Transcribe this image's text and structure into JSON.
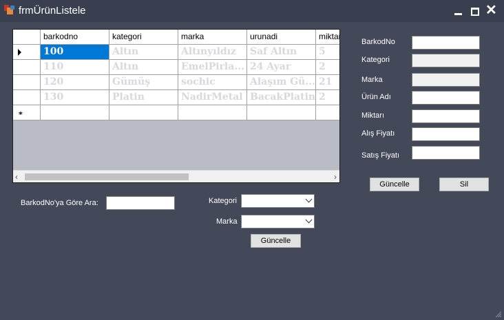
{
  "window": {
    "title": "frmÜrünListele"
  },
  "grid": {
    "columns": [
      "barkodno",
      "kategori",
      "marka",
      "urunadi",
      "miktar"
    ],
    "rows": [
      [
        "100",
        "Altın",
        "Altınyıldız",
        "Saf Altın",
        "5"
      ],
      [
        "110",
        "Altın",
        "EmelPirla...",
        "24 Ayar",
        "2"
      ],
      [
        "120",
        "Gümüş",
        "sochic",
        "Alaşım Gü...",
        "21"
      ],
      [
        "130",
        "Platin",
        "NadirMetal",
        "BacakPlatin",
        "2"
      ]
    ],
    "new_row_marker": "*"
  },
  "form": {
    "barkodno_label": "BarkodNo",
    "kategori_label": "Kategori",
    "marka_label": "Marka",
    "urunadi_label": "Ürün Adı",
    "miktar_label": "Miktarı",
    "alis_label": "Alış Fiyatı",
    "satis_label": "Satış Fiyatı",
    "guncelle_label": "Güncelle",
    "sil_label": "Sil"
  },
  "search": {
    "barkod_label": "BarkodNo'ya Göre Ara:",
    "kategori_label": "Kategori",
    "marka_label": "Marka",
    "guncelle_label": "Güncelle"
  },
  "colors": {
    "background": "#44495a",
    "titlebar": "#3a3f4f",
    "selection": "#0078d7"
  }
}
